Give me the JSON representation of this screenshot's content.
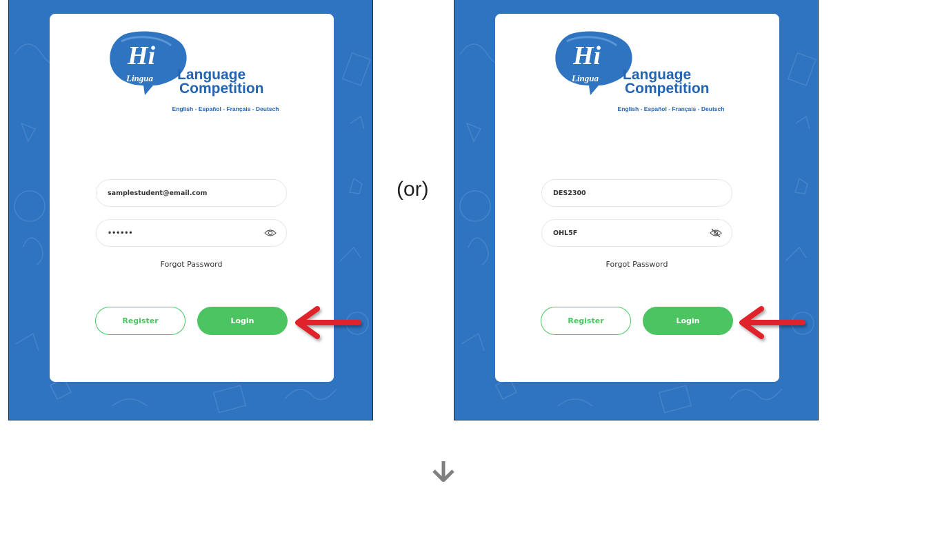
{
  "separator": "(or)",
  "brand": {
    "logo_text_hi": "Hi",
    "logo_text_lingua": "Lingua",
    "title_line1": "Language",
    "title_line2": "Competition",
    "languages": "English - Español - Français - Deutsch"
  },
  "panels": [
    {
      "username": "samplestudent@email.com",
      "password": "••••••",
      "password_icon": "eye-icon",
      "forgot_label": "Forgot Password",
      "register_label": "Register",
      "login_label": "Login"
    },
    {
      "username": "DES2300",
      "password": "OHL5F",
      "password_icon": "eye-off-icon",
      "forgot_label": "Forgot Password",
      "register_label": "Register",
      "login_label": "Login"
    }
  ],
  "colors": {
    "background_blue": "#2f74c0",
    "brand_blue": "#2564b0",
    "button_green": "#4cc462",
    "arrow_red": "#e0222a",
    "down_arrow_gray": "#808080"
  }
}
